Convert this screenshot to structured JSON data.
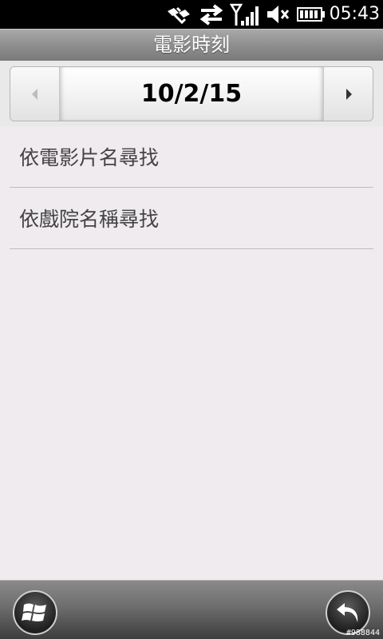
{
  "status_bar": {
    "time": "05:43",
    "icons": [
      "satellite-icon",
      "data-transfer-icon",
      "signal-strength-icon",
      "volume-muted-icon",
      "battery-icon"
    ]
  },
  "title": "電影時刻",
  "date_nav": {
    "date": "10/2/15",
    "prev_icon": "left-arrow-icon",
    "next_icon": "right-arrow-icon"
  },
  "menu": [
    {
      "label": "依電影片名尋找"
    },
    {
      "label": "依戲院名稱尋找"
    }
  ],
  "bottom_bar": {
    "start_icon": "windows-start-icon",
    "back_icon": "back-arrow-icon",
    "watermark": "#988844"
  }
}
